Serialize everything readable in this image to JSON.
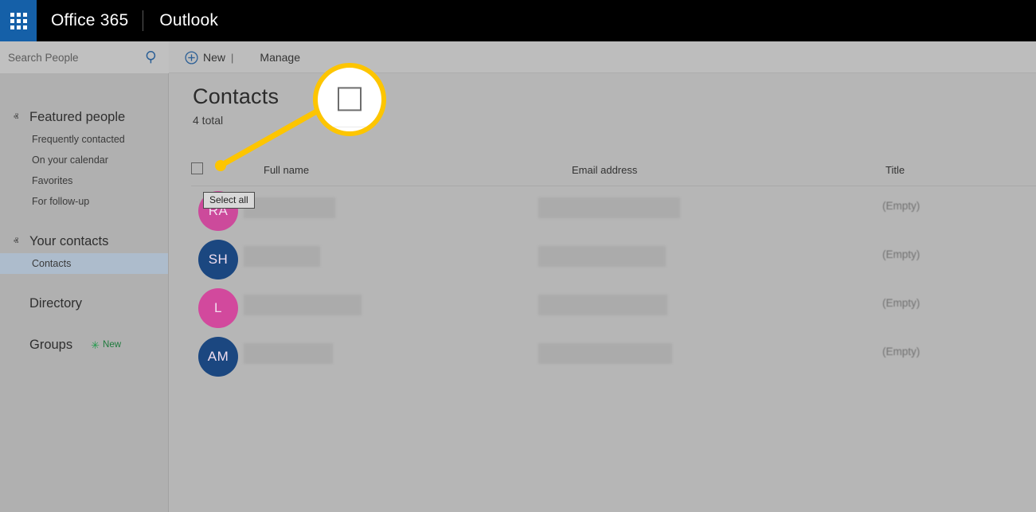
{
  "suite_bar": {
    "waffle_label": "app-launcher",
    "brand": "Office 365",
    "app": "Outlook"
  },
  "search": {
    "placeholder": "Search People",
    "value": "",
    "icon": "search-icon"
  },
  "toolbar": {
    "new_label": "New",
    "new_icon": "plus-circle-icon",
    "new_separator": "|",
    "new_caret": "ⱟ",
    "manage_label": "Manage",
    "manage_caret": "ⱟ"
  },
  "sidebar": {
    "groups": [
      {
        "label": "Featured people",
        "caret": "ⱏ",
        "expanded": true,
        "items": [
          {
            "label": "Frequently contacted",
            "selected": false
          },
          {
            "label": "On your calendar",
            "selected": false
          },
          {
            "label": "Favorites",
            "selected": false
          },
          {
            "label": "For follow-up",
            "selected": false
          }
        ]
      },
      {
        "label": "Your contacts",
        "caret": "ⱏ",
        "expanded": true,
        "items": [
          {
            "label": "Contacts",
            "selected": true
          }
        ]
      },
      {
        "label": "Directory",
        "caret": "ⱟ",
        "expanded": false,
        "items": []
      },
      {
        "label": "Groups",
        "caret": "ⱟ",
        "expanded": false,
        "badge": {
          "icon": "sparkle-icon",
          "glyph": "✳",
          "text": "New"
        },
        "items": []
      }
    ]
  },
  "main": {
    "title": "Contacts",
    "count_text": "4 total",
    "select_all_tooltip": "Select all",
    "columns": [
      "Full name",
      "Email address",
      "Title"
    ],
    "rows": [
      {
        "initials": "RA",
        "avatar_color": "#cc4a9b",
        "full_name": "",
        "email": "",
        "title": "(Empty)",
        "name_redacted_width": 115,
        "email_redacted_width": 178
      },
      {
        "initials": "SH",
        "avatar_color": "#1b4780",
        "full_name": "",
        "email": "",
        "title": "(Empty)",
        "name_redacted_width": 96,
        "email_redacted_width": 160
      },
      {
        "initials": "L",
        "avatar_color": "#d2499d",
        "full_name": "",
        "email": "",
        "title": "(Empty)",
        "name_redacted_width": 148,
        "email_redacted_width": 162
      },
      {
        "initials": "AM",
        "avatar_color": "#1b4780",
        "full_name": "",
        "email": "",
        "title": "(Empty)",
        "name_redacted_width": 112,
        "email_redacted_width": 168
      }
    ]
  },
  "callout": {
    "highlight_color": "#fdc500",
    "target": "select-all-checkbox",
    "zoom_icon": "checkbox-icon"
  },
  "colors": {
    "suite_bar_bg": "#000000",
    "waffle_bg": "#1560a8",
    "content_bg": "#b6b6b6",
    "nav_bg": "#b0b0b0",
    "nav_selected_bg": "#adbccc",
    "redaction": "#ababab"
  }
}
